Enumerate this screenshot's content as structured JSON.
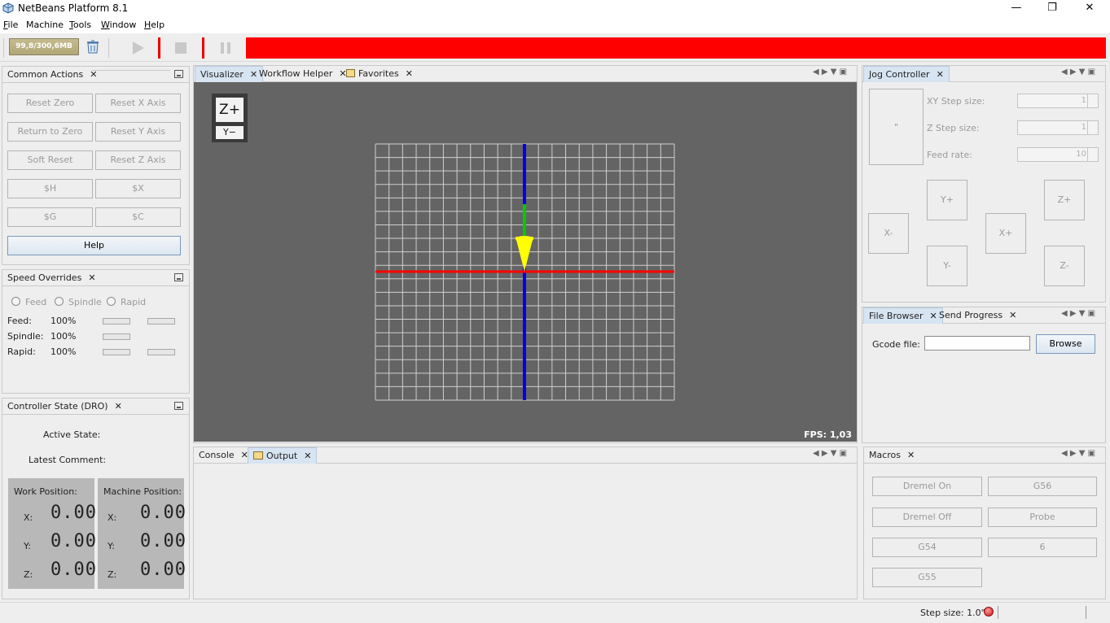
{
  "window": {
    "title": "NetBeans Platform 8.1",
    "minimize": "—",
    "maximize": "❐",
    "close": "✕"
  },
  "menu": [
    {
      "label": "File",
      "mn": "F",
      "rest": "ile"
    },
    {
      "label": "Machine",
      "mn": "",
      "rest": "Machine"
    },
    {
      "label": "Tools",
      "mn": "T",
      "rest": "ools"
    },
    {
      "label": "Window",
      "mn": "W",
      "rest": "indow"
    },
    {
      "label": "Help",
      "mn": "H",
      "rest": "elp"
    }
  ],
  "toolbar": {
    "memory": "99,8/300,6MB",
    "status_color": "#ff0000"
  },
  "common_actions": {
    "tab": "Common Actions",
    "buttons": [
      "Reset Zero",
      "Reset X Axis",
      "Return to Zero",
      "Reset Y Axis",
      "Soft Reset",
      "Reset Z Axis",
      "$H",
      "$X",
      "$G",
      "$C"
    ],
    "help": "Help"
  },
  "speed_overrides": {
    "tab": "Speed Overrides",
    "radios": [
      "Feed",
      "Spindle",
      "Rapid"
    ],
    "rows": [
      {
        "label": "Feed:",
        "value": "100%"
      },
      {
        "label": "Spindle:",
        "value": "100%"
      },
      {
        "label": "Rapid:",
        "value": "100%"
      }
    ]
  },
  "dro": {
    "tab": "Controller State (DRO)",
    "active_state_label": "Active State:",
    "latest_comment_label": "Latest Comment:",
    "work_title": "Work Position:",
    "machine_title": "Machine Position:",
    "axes": [
      "X:",
      "Y:",
      "Z:"
    ],
    "work": [
      "0.00",
      "0.00",
      "0.00"
    ],
    "machine": [
      "0.00",
      "0.00",
      "0.00"
    ]
  },
  "center_tabs": [
    "Visualizer",
    "Workflow Helper",
    "Favorites"
  ],
  "visualizer": {
    "fps": "FPS: 1,03",
    "cube_top": "Z+",
    "cube_bottom": "Y−",
    "colors": {
      "x_axis": "#ff0000",
      "y_axis": "#0000ee",
      "tool_stem": "#00cc00",
      "tool": "#ffff00",
      "grid": "#cfcfcf"
    }
  },
  "bottom_tabs": [
    "Console",
    "Output"
  ],
  "jog": {
    "tab": "Jog Controller",
    "preview": "\"",
    "xy_step_label": "XY Step size:",
    "xy_step": "1",
    "z_step_label": "Z Step size:",
    "z_step": "1",
    "feed_label": "Feed rate:",
    "feed": "10",
    "buttons": {
      "yplus": "Y+",
      "zplus": "Z+",
      "xminus": "X-",
      "xplus": "X+",
      "yminus": "Y-",
      "zminus": "Z-"
    }
  },
  "file_browser": {
    "tabs": [
      "File Browser",
      "Send Progress"
    ],
    "gcode_label": "Gcode file:",
    "gcode_value": "",
    "browse": "Browse"
  },
  "macros": {
    "tab": "Macros",
    "buttons": [
      "Dremel On",
      "G56",
      "Dremel Off",
      "Probe",
      "G54",
      "6",
      "G55"
    ]
  },
  "statusbar": {
    "step_size": "Step size: 1.0\""
  }
}
